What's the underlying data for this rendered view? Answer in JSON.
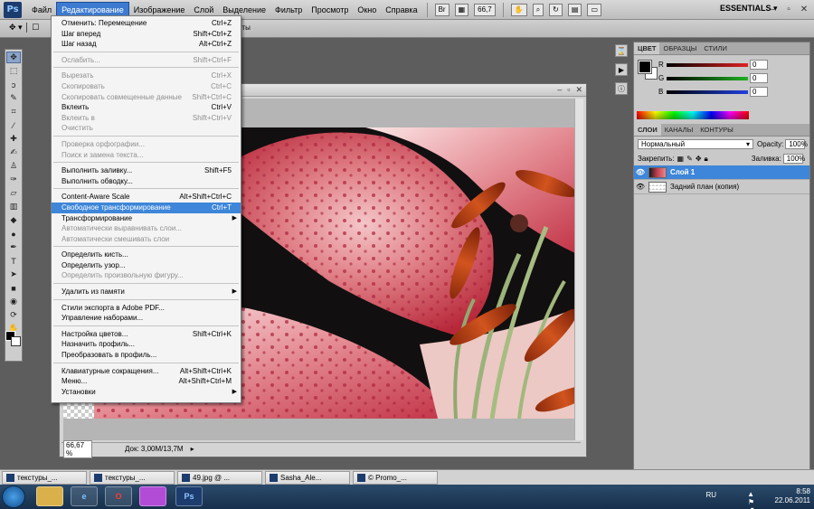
{
  "menubar": {
    "logo": "Ps",
    "items": [
      "Файл",
      "Редактирование",
      "Изображение",
      "Слой",
      "Выделение",
      "Фильтр",
      "Просмотр",
      "Окно",
      "Справка"
    ],
    "active_index": 1,
    "zoom": "66,7",
    "workspace": "ESSENTIALS"
  },
  "edit_menu": {
    "items": [
      {
        "label": "Отменить: Перемещение",
        "shortcut": "Ctrl+Z",
        "disabled": false
      },
      {
        "label": "Шаг вперед",
        "shortcut": "Shift+Ctrl+Z",
        "disabled": false
      },
      {
        "label": "Шаг назад",
        "shortcut": "Alt+Ctrl+Z",
        "disabled": false
      },
      {
        "sep": true
      },
      {
        "label": "Ослабить...",
        "shortcut": "Shift+Ctrl+F",
        "disabled": true
      },
      {
        "sep": true
      },
      {
        "label": "Вырезать",
        "shortcut": "Ctrl+X",
        "disabled": true
      },
      {
        "label": "Скопировать",
        "shortcut": "Ctrl+C",
        "disabled": true
      },
      {
        "label": "Скопировать совмещенные данные",
        "shortcut": "Shift+Ctrl+C",
        "disabled": true
      },
      {
        "label": "Вклеить",
        "shortcut": "Ctrl+V",
        "disabled": false
      },
      {
        "label": "Вклеить в",
        "shortcut": "Shift+Ctrl+V",
        "disabled": true
      },
      {
        "label": "Очистить",
        "shortcut": "",
        "disabled": true
      },
      {
        "sep": true
      },
      {
        "label": "Проверка орфографии...",
        "shortcut": "",
        "disabled": true
      },
      {
        "label": "Поиск и замена текста...",
        "shortcut": "",
        "disabled": true
      },
      {
        "sep": true
      },
      {
        "label": "Выполнить заливку...",
        "shortcut": "Shift+F5",
        "disabled": false
      },
      {
        "label": "Выполнить обводку...",
        "shortcut": "",
        "disabled": false
      },
      {
        "sep": true
      },
      {
        "label": "Content-Aware Scale",
        "shortcut": "Alt+Shift+Ctrl+C",
        "disabled": false
      },
      {
        "label": "Свободное трансформирование",
        "shortcut": "Ctrl+T",
        "disabled": false,
        "highlight": true
      },
      {
        "label": "Трансформирование",
        "shortcut": "",
        "disabled": false,
        "submenu": true
      },
      {
        "label": "Автоматически выравнивать слои...",
        "shortcut": "",
        "disabled": true
      },
      {
        "label": "Автоматически смешивать слои",
        "shortcut": "",
        "disabled": true
      },
      {
        "sep": true
      },
      {
        "label": "Определить кисть...",
        "shortcut": "",
        "disabled": false
      },
      {
        "label": "Определить узор...",
        "shortcut": "",
        "disabled": false
      },
      {
        "label": "Определить произвольную фигуру...",
        "shortcut": "",
        "disabled": true
      },
      {
        "sep": true
      },
      {
        "label": "Удалить из памяти",
        "shortcut": "",
        "disabled": false,
        "submenu": true
      },
      {
        "sep": true
      },
      {
        "label": "Стили экспорта в Adobe PDF...",
        "shortcut": "",
        "disabled": false
      },
      {
        "label": "Управление наборами...",
        "shortcut": "",
        "disabled": false
      },
      {
        "sep": true
      },
      {
        "label": "Настройка цветов...",
        "shortcut": "Shift+Ctrl+K",
        "disabled": false
      },
      {
        "label": "Назначить профиль...",
        "shortcut": "",
        "disabled": false
      },
      {
        "label": "Преобразовать в профиль...",
        "shortcut": "",
        "disabled": false
      },
      {
        "sep": true
      },
      {
        "label": "Клавиатурные сокращения...",
        "shortcut": "Alt+Shift+Ctrl+K",
        "disabled": false
      },
      {
        "label": "Меню...",
        "shortcut": "Alt+Shift+Ctrl+M",
        "disabled": false
      },
      {
        "label": "Установки",
        "shortcut": "",
        "disabled": false,
        "submenu": true
      }
    ]
  },
  "options_bar": {
    "tail_text": "нты"
  },
  "document": {
    "status_zoom": "66,67 %",
    "status_info": "Док: 3,00M/13,7M"
  },
  "panels": {
    "color_tabs": [
      "ЦВЕТ",
      "ОБРАЗЦЫ",
      "СТИЛИ"
    ],
    "rgb": [
      {
        "label": "R",
        "value": "0",
        "color": "#e02020"
      },
      {
        "label": "G",
        "value": "0",
        "color": "#20b020"
      },
      {
        "label": "B",
        "value": "0",
        "color": "#2040e0"
      }
    ],
    "layer_tabs": [
      "СЛОИ",
      "КАНАЛЫ",
      "КОНТУРЫ"
    ],
    "blend_mode": "Нормальный",
    "opacity_label": "Opacity:",
    "opacity_value": "100%",
    "lock_label": "Закрепить:",
    "fill_label": "Заливка:",
    "fill_value": "100%",
    "layers": [
      {
        "name": "Слой 1",
        "selected": true
      },
      {
        "name": "Задний план (копия)",
        "selected": false
      }
    ]
  },
  "doc_tabs": [
    "текстуры_...",
    "текстуры_...",
    "49.jpg @ ...",
    "Sasha_Ale...",
    "© Promo_..."
  ],
  "taskbar": {
    "lang": "RU",
    "time": "8:58",
    "date": "22.06.2011",
    "apps": [
      "",
      "e",
      "O",
      "",
      "Ps"
    ]
  }
}
